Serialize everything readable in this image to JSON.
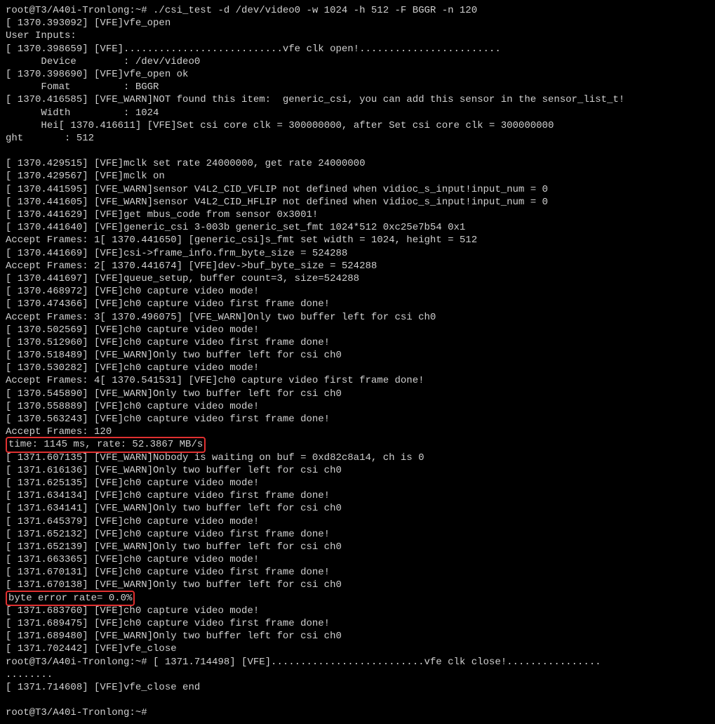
{
  "lines": [
    {
      "t": "root@T3/A40i-Tronlong:~# ./csi_test -d /dev/video0 -w 1024 -h 512 -F BGGR -n 120"
    },
    {
      "t": "[ 1370.393092] [VFE]vfe_open"
    },
    {
      "t": "User Inputs:"
    },
    {
      "t": "[ 1370.398659] [VFE]...........................vfe clk open!........................"
    },
    {
      "t": "      Device        : /dev/video0"
    },
    {
      "t": "[ 1370.398690] [VFE]vfe_open ok"
    },
    {
      "t": "      Fomat         : BGGR"
    },
    {
      "t": "[ 1370.416585] [VFE_WARN]NOT found this item:  generic_csi, you can add this sensor in the sensor_list_t!"
    },
    {
      "t": "      Width         : 1024"
    },
    {
      "t": "      Hei[ 1370.416611] [VFE]Set csi core clk = 300000000, after Set csi core clk = 300000000"
    },
    {
      "t": "ght       : 512"
    },
    {
      "t": ""
    },
    {
      "t": "[ 1370.429515] [VFE]mclk set rate 24000000, get rate 24000000"
    },
    {
      "t": "[ 1370.429567] [VFE]mclk on"
    },
    {
      "t": "[ 1370.441595] [VFE_WARN]sensor V4L2_CID_VFLIP not defined when vidioc_s_input!input_num = 0"
    },
    {
      "t": "[ 1370.441605] [VFE_WARN]sensor V4L2_CID_HFLIP not defined when vidioc_s_input!input_num = 0"
    },
    {
      "t": "[ 1370.441629] [VFE]get mbus_code from sensor 0x3001!"
    },
    {
      "t": "[ 1370.441640] [VFE]generic_csi 3-003b generic_set_fmt 1024*512 0xc25e7b54 0x1"
    },
    {
      "t": "Accept Frames: 1[ 1370.441650] [generic_csi]s_fmt set width = 1024, height = 512"
    },
    {
      "t": "[ 1370.441669] [VFE]csi->frame_info.frm_byte_size = 524288"
    },
    {
      "t": "Accept Frames: 2[ 1370.441674] [VFE]dev->buf_byte_size = 524288"
    },
    {
      "t": "[ 1370.441697] [VFE]queue_setup, buffer count=3, size=524288"
    },
    {
      "t": "[ 1370.468972] [VFE]ch0 capture video mode!"
    },
    {
      "t": "[ 1370.474366] [VFE]ch0 capture video first frame done!"
    },
    {
      "t": "Accept Frames: 3[ 1370.496075] [VFE_WARN]Only two buffer left for csi ch0"
    },
    {
      "t": "[ 1370.502569] [VFE]ch0 capture video mode!"
    },
    {
      "t": "[ 1370.512960] [VFE]ch0 capture video first frame done!"
    },
    {
      "t": "[ 1370.518489] [VFE_WARN]Only two buffer left for csi ch0"
    },
    {
      "t": "[ 1370.530282] [VFE]ch0 capture video mode!"
    },
    {
      "t": "Accept Frames: 4[ 1370.541531] [VFE]ch0 capture video first frame done!"
    },
    {
      "t": "[ 1370.545890] [VFE_WARN]Only two buffer left for csi ch0"
    },
    {
      "t": "[ 1370.558889] [VFE]ch0 capture video mode!"
    },
    {
      "t": "[ 1370.563243] [VFE]ch0 capture video first frame done!"
    },
    {
      "t": "Accept Frames: 120"
    },
    {
      "t": "time: 1145 ms, rate: 52.3867 MB/s",
      "hl": true
    },
    {
      "t": "[ 1371.607135] [VFE_WARN]Nobody is waiting on buf = 0xd82c8a14, ch is 0"
    },
    {
      "t": "[ 1371.616136] [VFE_WARN]Only two buffer left for csi ch0"
    },
    {
      "t": "[ 1371.625135] [VFE]ch0 capture video mode!"
    },
    {
      "t": "[ 1371.634134] [VFE]ch0 capture video first frame done!"
    },
    {
      "t": "[ 1371.634141] [VFE_WARN]Only two buffer left for csi ch0"
    },
    {
      "t": "[ 1371.645379] [VFE]ch0 capture video mode!"
    },
    {
      "t": "[ 1371.652132] [VFE]ch0 capture video first frame done!"
    },
    {
      "t": "[ 1371.652139] [VFE_WARN]Only two buffer left for csi ch0"
    },
    {
      "t": "[ 1371.663365] [VFE]ch0 capture video mode!"
    },
    {
      "t": "[ 1371.670131] [VFE]ch0 capture video first frame done!"
    },
    {
      "t": "[ 1371.670138] [VFE_WARN]Only two buffer left for csi ch0"
    },
    {
      "t": "byte error rate= 0.0%",
      "hl": true
    },
    {
      "t": "[ 1371.683760] [VFE]ch0 capture video mode!"
    },
    {
      "t": "[ 1371.689475] [VFE]ch0 capture video first frame done!"
    },
    {
      "t": "[ 1371.689480] [VFE_WARN]Only two buffer left for csi ch0"
    },
    {
      "t": "[ 1371.702442] [VFE]vfe_close"
    },
    {
      "t": "root@T3/A40i-Tronlong:~# [ 1371.714498] [VFE]..........................vfe clk close!................"
    },
    {
      "t": "........"
    },
    {
      "t": "[ 1371.714608] [VFE]vfe_close end"
    },
    {
      "t": ""
    },
    {
      "t": "root@T3/A40i-Tronlong:~#"
    }
  ]
}
